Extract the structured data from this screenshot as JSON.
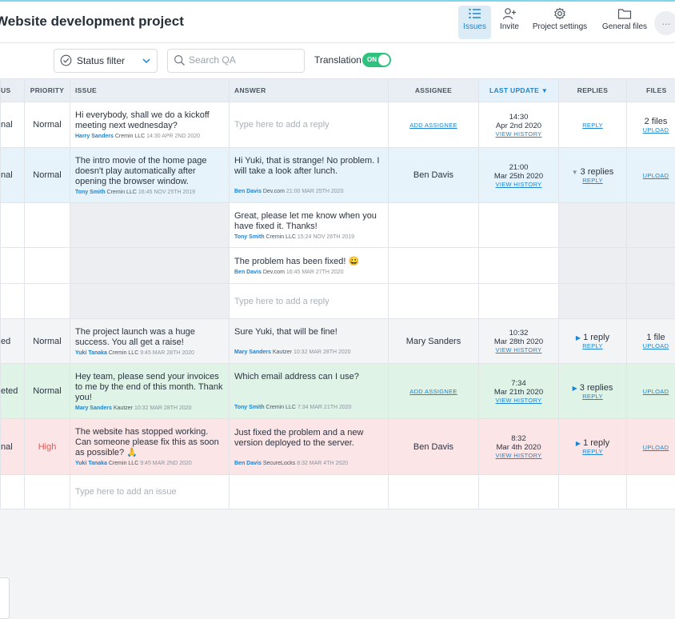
{
  "header": {
    "title": "Website development project",
    "nav": [
      {
        "label": "Issues",
        "icon": "list-icon",
        "active": true
      },
      {
        "label": "Invite",
        "icon": "add-person-icon",
        "active": false
      },
      {
        "label": "Project settings",
        "icon": "gear-icon",
        "active": false
      },
      {
        "label": "General files",
        "icon": "folder-icon",
        "active": false
      }
    ],
    "more_label": "..."
  },
  "filters": {
    "status_filter_label": "Status filter",
    "search_placeholder": "Search QA",
    "translation_label": "Translation",
    "translation_toggle": "ON"
  },
  "columns": {
    "status": "US",
    "priority": "PRIORITY",
    "issue": "ISSUE",
    "answer": "ANSWER",
    "assignee": "ASSIGNEE",
    "last_update": "LAST UPDATE",
    "replies": "REPLIES",
    "files": "FILES"
  },
  "rows": {
    "r1": {
      "status": "nal",
      "priority": "Normal",
      "issue": "Hi everybody, shall we do a kickoff meeting next wednesday?",
      "issue_author": "Harry Sanders",
      "issue_company": "Cremin LLC",
      "issue_time": "14:30 APR 2ND 2020",
      "answer_placeholder": "Type here to add a reply",
      "assignee_link": "ADD ASSIGNEE",
      "update_time": "14:30",
      "update_date": "Apr 2nd 2020",
      "history": "VIEW HISTORY",
      "reply_link": "REPLY",
      "files": "2 files",
      "upload": "UPLOAD"
    },
    "r2": {
      "status": "nal",
      "priority": "Normal",
      "issue": "The intro movie of the home page doesn't play automatically after opening the browser window.",
      "issue_author": "Tony Smith",
      "issue_company": "Cremin LLC",
      "issue_time": "16:45 NOV 25TH 2019",
      "answer": "Hi Yuki, that is strange! No problem. I will take a look after lunch.",
      "answer_author": "Ben Davis",
      "answer_company": "Dev.com",
      "answer_time": "21:00 MAR 25TH 2020",
      "assignee": "Ben Davis",
      "update_time": "21:00",
      "update_date": "Mar 25th 2020",
      "history": "VIEW HISTORY",
      "replies": "3 replies",
      "reply_link": "REPLY",
      "upload": "UPLOAD"
    },
    "r2b": {
      "answer": "Great, please let me know when you have fixed it. Thanks!",
      "answer_author": "Tony Smith",
      "answer_company": "Cremin LLC",
      "answer_time": "15:24 NOV 26TH 2019"
    },
    "r2c": {
      "answer": "The problem has been fixed! 😀",
      "answer_author": "Ben Davis",
      "answer_company": "Dev.com",
      "answer_time": "16:45 MAR 27TH 2020"
    },
    "r2d": {
      "answer_placeholder": "Type here to add a reply"
    },
    "r3": {
      "status": "ed",
      "priority": "Normal",
      "issue": "The project launch was a huge success. You all get a raise!",
      "issue_author": "Yuki Tanaka",
      "issue_company": "Cremin LLC",
      "issue_time": "9:45 MAR 28TH 2020",
      "answer": "Sure Yuki, that will be fine!",
      "answer_author": "Mary Sanders",
      "answer_company": "Kautzer",
      "answer_time": "10:32 MAR 28TH 2020",
      "assignee": "Mary Sanders",
      "update_time": "10:32",
      "update_date": "Mar 28th 2020",
      "history": "VIEW HISTORY",
      "replies": "1 reply",
      "reply_link": "REPLY",
      "files": "1 file",
      "upload": "UPLOAD"
    },
    "r4": {
      "status": "eted",
      "priority": "Normal",
      "issue": "Hey team, please send your invoices to me by the end of this month. Thank you!",
      "issue_author": "Mary Sanders",
      "issue_company": "Kautzer",
      "issue_time": "10:32 MAR 28TH 2020",
      "answer": "Which email address can I use?",
      "answer_author": "Tony Smith",
      "answer_company": "Cremin LLC",
      "answer_time": "7:34 MAR 21TH 2020",
      "assignee_link": "ADD ASSIGNEE",
      "update_time": "7:34",
      "update_date": "Mar 21th 2020",
      "history": "VIEW HISTORY",
      "replies": "3 replies",
      "reply_link": "REPLY",
      "upload": "UPLOAD"
    },
    "r5": {
      "status": "nal",
      "priority": "High",
      "issue": "The website has stopped working. Can someone please fix this as soon as possible? 🙏",
      "issue_author": "Yuki Tanaka",
      "issue_company": "Cremin LLC",
      "issue_time": "9:45 MAR 2ND 2020",
      "answer": "Just fixed the problem and a new version deployed to the server.",
      "answer_author": "Ben Davis",
      "answer_company": "SecureLocks",
      "answer_time": "8:32 MAR 4TH 2020",
      "assignee": "Ben Davis",
      "update_time": "8:32",
      "update_date": "Mar 4th 2020",
      "history": "VIEW HISTORY",
      "replies": "1 reply",
      "reply_link": "REPLY",
      "upload": "UPLOAD"
    },
    "new_issue_placeholder": "Type here to add an issue"
  },
  "colors": {
    "accent": "#1c84d0",
    "toggle_on": "#2ec27e",
    "high_priority": "#e8544e",
    "row_blue": "#e6f3fb",
    "row_green": "#dff3e7",
    "row_red": "#fbe5e6"
  }
}
